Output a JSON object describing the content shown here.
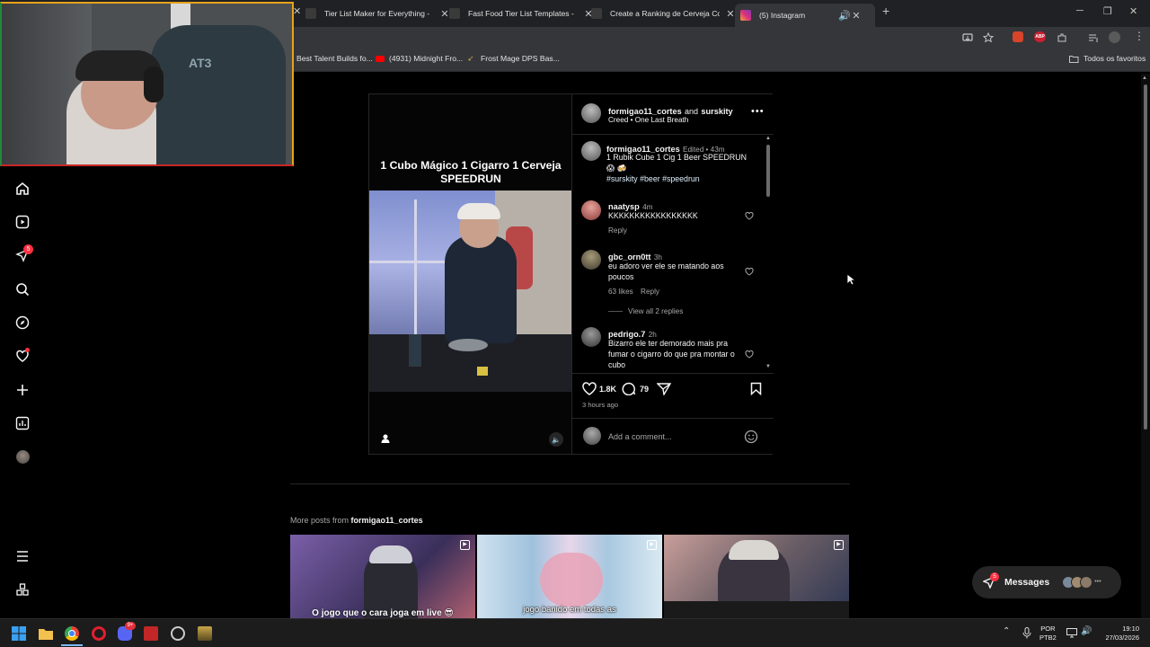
{
  "browser": {
    "tabs": [
      {
        "title": "Tier List Maker for Everything -",
        "active": false
      },
      {
        "title": "Fast Food Tier List Templates -",
        "active": false
      },
      {
        "title": "Create a Ranking de Cerveja Co",
        "active": false
      },
      {
        "title": "(5) Instagram",
        "active": true
      }
    ],
    "bookmarks": [
      "Best Talent Builds fo...",
      "(4931) Midnight Fro...",
      "Frost Mage DPS Bas..."
    ],
    "all_bookmarks_label": "Todos os favoritos"
  },
  "sidebar": {
    "notification_badge": "5",
    "items": [
      "home-icon",
      "reels-icon",
      "messages-icon",
      "search-icon",
      "explore-icon",
      "notifications-icon",
      "create-icon",
      "dashboard-icon",
      "profile-avatar"
    ],
    "bottom": [
      "menu-icon",
      "more-apps-icon"
    ]
  },
  "post": {
    "video_overlay_title": "1 Cubo Mágico 1 Cigarro 1 Cerveja SPEEDRUN",
    "header": {
      "author": "formigao11_cortes",
      "and_label": "and",
      "collaborator": "surskity",
      "audio": "Creed • One Last Breath"
    },
    "caption": {
      "user": "formigao11_cortes",
      "meta": "Edited • 43m",
      "text": "1 Rubik Cube 1 Cig 1 Beer SPEEDRUN",
      "emoji": "😱 🍻",
      "tags": "#surskity #beer #speedrun"
    },
    "comments": [
      {
        "user": "naatysp",
        "time": "4m",
        "text": "KKKKKKKKKKKKKKKKK",
        "reply_label": "Reply",
        "likes": ""
      },
      {
        "user": "gbc_orn0tt",
        "time": "3h",
        "text": "eu adoro ver ele se matando aos poucos",
        "likes": "63 likes",
        "reply_label": "Reply",
        "view_replies": "View all 2 replies"
      },
      {
        "user": "pedrigo.7",
        "time": "2h",
        "text": "Bizarro ele ter demorado mais pra fumar o cigarro do que pra montar o cubo"
      }
    ],
    "like_count": "1.8K",
    "comment_count": "79",
    "posted_ago": "3 hours ago",
    "comment_placeholder": "Add a comment..."
  },
  "more_posts": {
    "label_prefix": "More posts from",
    "user": "formigao11_cortes",
    "thumbs": [
      {
        "caption": "O jogo que o cara joga em live 😎"
      },
      {
        "caption": "jogo banido em todas as"
      },
      {
        "caption": ""
      }
    ]
  },
  "messages_button": {
    "label": "Messages",
    "badge": "5"
  },
  "taskbar": {
    "lang_top": "POR",
    "lang_bottom": "PTB2",
    "time": "19:10",
    "date": "27/03/2026",
    "discord_badge": "9+"
  },
  "webcam": {
    "chair_text": "AT3"
  },
  "colors": {
    "accent_blue": "#e0f1ff",
    "hashtag": "#e0f1ff",
    "link": "#708dff",
    "badge": "#ff3040"
  }
}
